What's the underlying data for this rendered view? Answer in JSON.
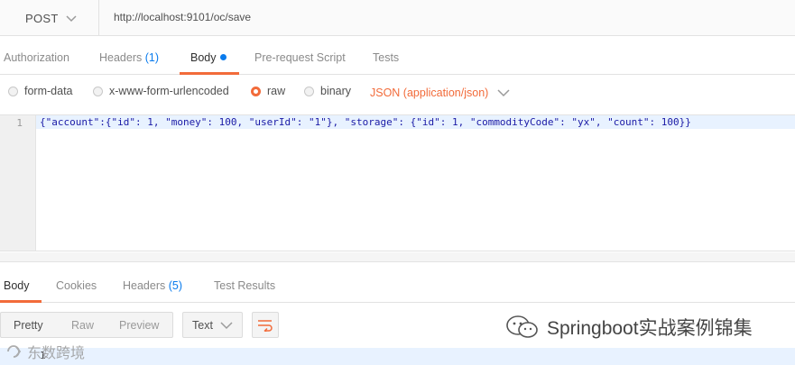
{
  "request": {
    "method": "POST",
    "url": "http://localhost:9101/oc/save"
  },
  "request_tabs": {
    "authorization": "Authorization",
    "headers": "Headers",
    "headers_count": "(1)",
    "body": "Body",
    "prerequest": "Pre-request Script",
    "tests": "Tests"
  },
  "body_types": {
    "form_data": "form-data",
    "urlencoded": "x-www-form-urlencoded",
    "raw": "raw",
    "binary": "binary",
    "selected": "raw",
    "content_type": "JSON (application/json)"
  },
  "editor": {
    "line_number": "1",
    "code": "{\"account\":{\"id\": 1, \"money\": 100, \"userId\": \"1\"}, \"storage\": {\"id\": 1, \"commodityCode\": \"yx\", \"count\": 100}}"
  },
  "response_tabs": {
    "body": "Body",
    "cookies": "Cookies",
    "headers": "Headers",
    "headers_count": "(5)",
    "test_results": "Test Results"
  },
  "response_toolbar": {
    "pretty": "Pretty",
    "raw": "Raw",
    "preview": "Preview",
    "format": "Text"
  },
  "response_body": {
    "line_number": "1"
  },
  "watermarks": {
    "channel": "Springboot实战案例锦集",
    "corner": "东数跨境"
  },
  "colors": {
    "accent": "#f26b3a",
    "link_blue": "#097bed",
    "line_highlight": "#e8f2ff"
  }
}
